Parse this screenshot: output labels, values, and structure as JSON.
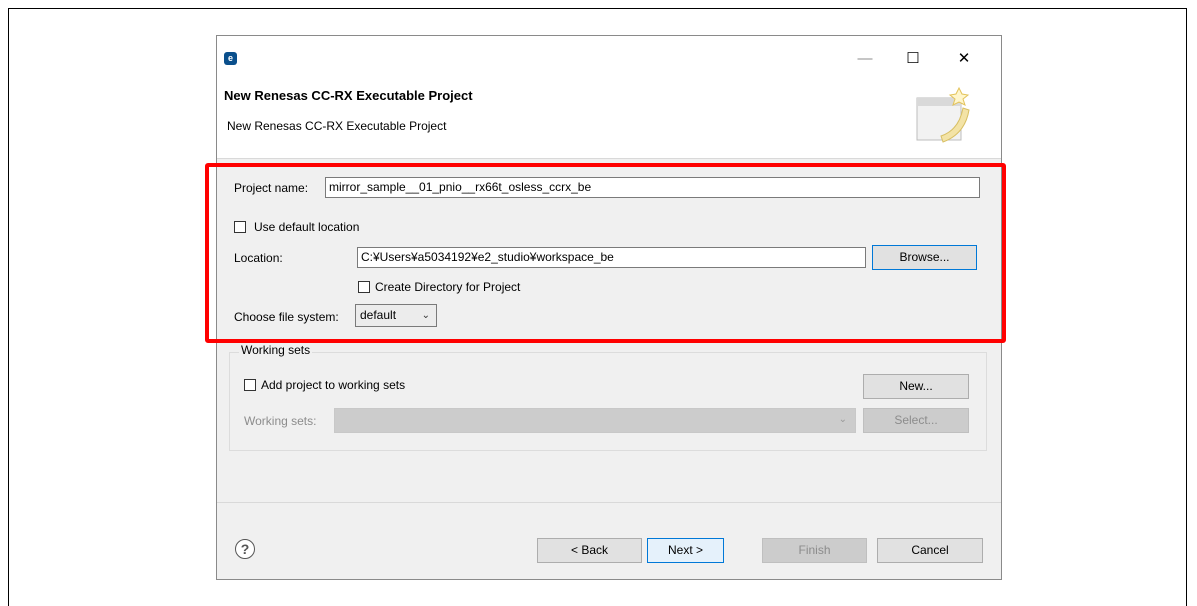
{
  "window": {
    "app_icon": "e2-studio-icon",
    "minimize": "—",
    "maximize": "☐",
    "close": "✕"
  },
  "header": {
    "title": "New Renesas CC-RX Executable Project",
    "subtitle": "New Renesas CC-RX Executable Project"
  },
  "form": {
    "project_name_label": "Project name:",
    "project_name_value": "mirror_sample__01_pnio__rx66t_osless_ccrx_be",
    "use_default_location_label": "Use default location",
    "use_default_location_checked": false,
    "location_label": "Location:",
    "location_value": "C:¥Users¥a5034192¥e2_studio¥workspace_be",
    "browse_label": "Browse...",
    "create_directory_label": "Create Directory for Project",
    "create_directory_checked": false,
    "file_system_label": "Choose file system:",
    "file_system_value": "default"
  },
  "working_sets": {
    "group_title": "Working sets",
    "add_label": "Add project to working sets",
    "add_checked": false,
    "new_label": "New...",
    "sets_label": "Working sets:",
    "sets_value": "",
    "select_label": "Select..."
  },
  "footer": {
    "help_icon": "?",
    "back_label": "< Back",
    "next_label": "Next >",
    "finish_label": "Finish",
    "cancel_label": "Cancel"
  },
  "colors": {
    "highlight": "#ff0000",
    "default_button_border": "#0078d7",
    "dialog_background": "#f0f0f0"
  }
}
